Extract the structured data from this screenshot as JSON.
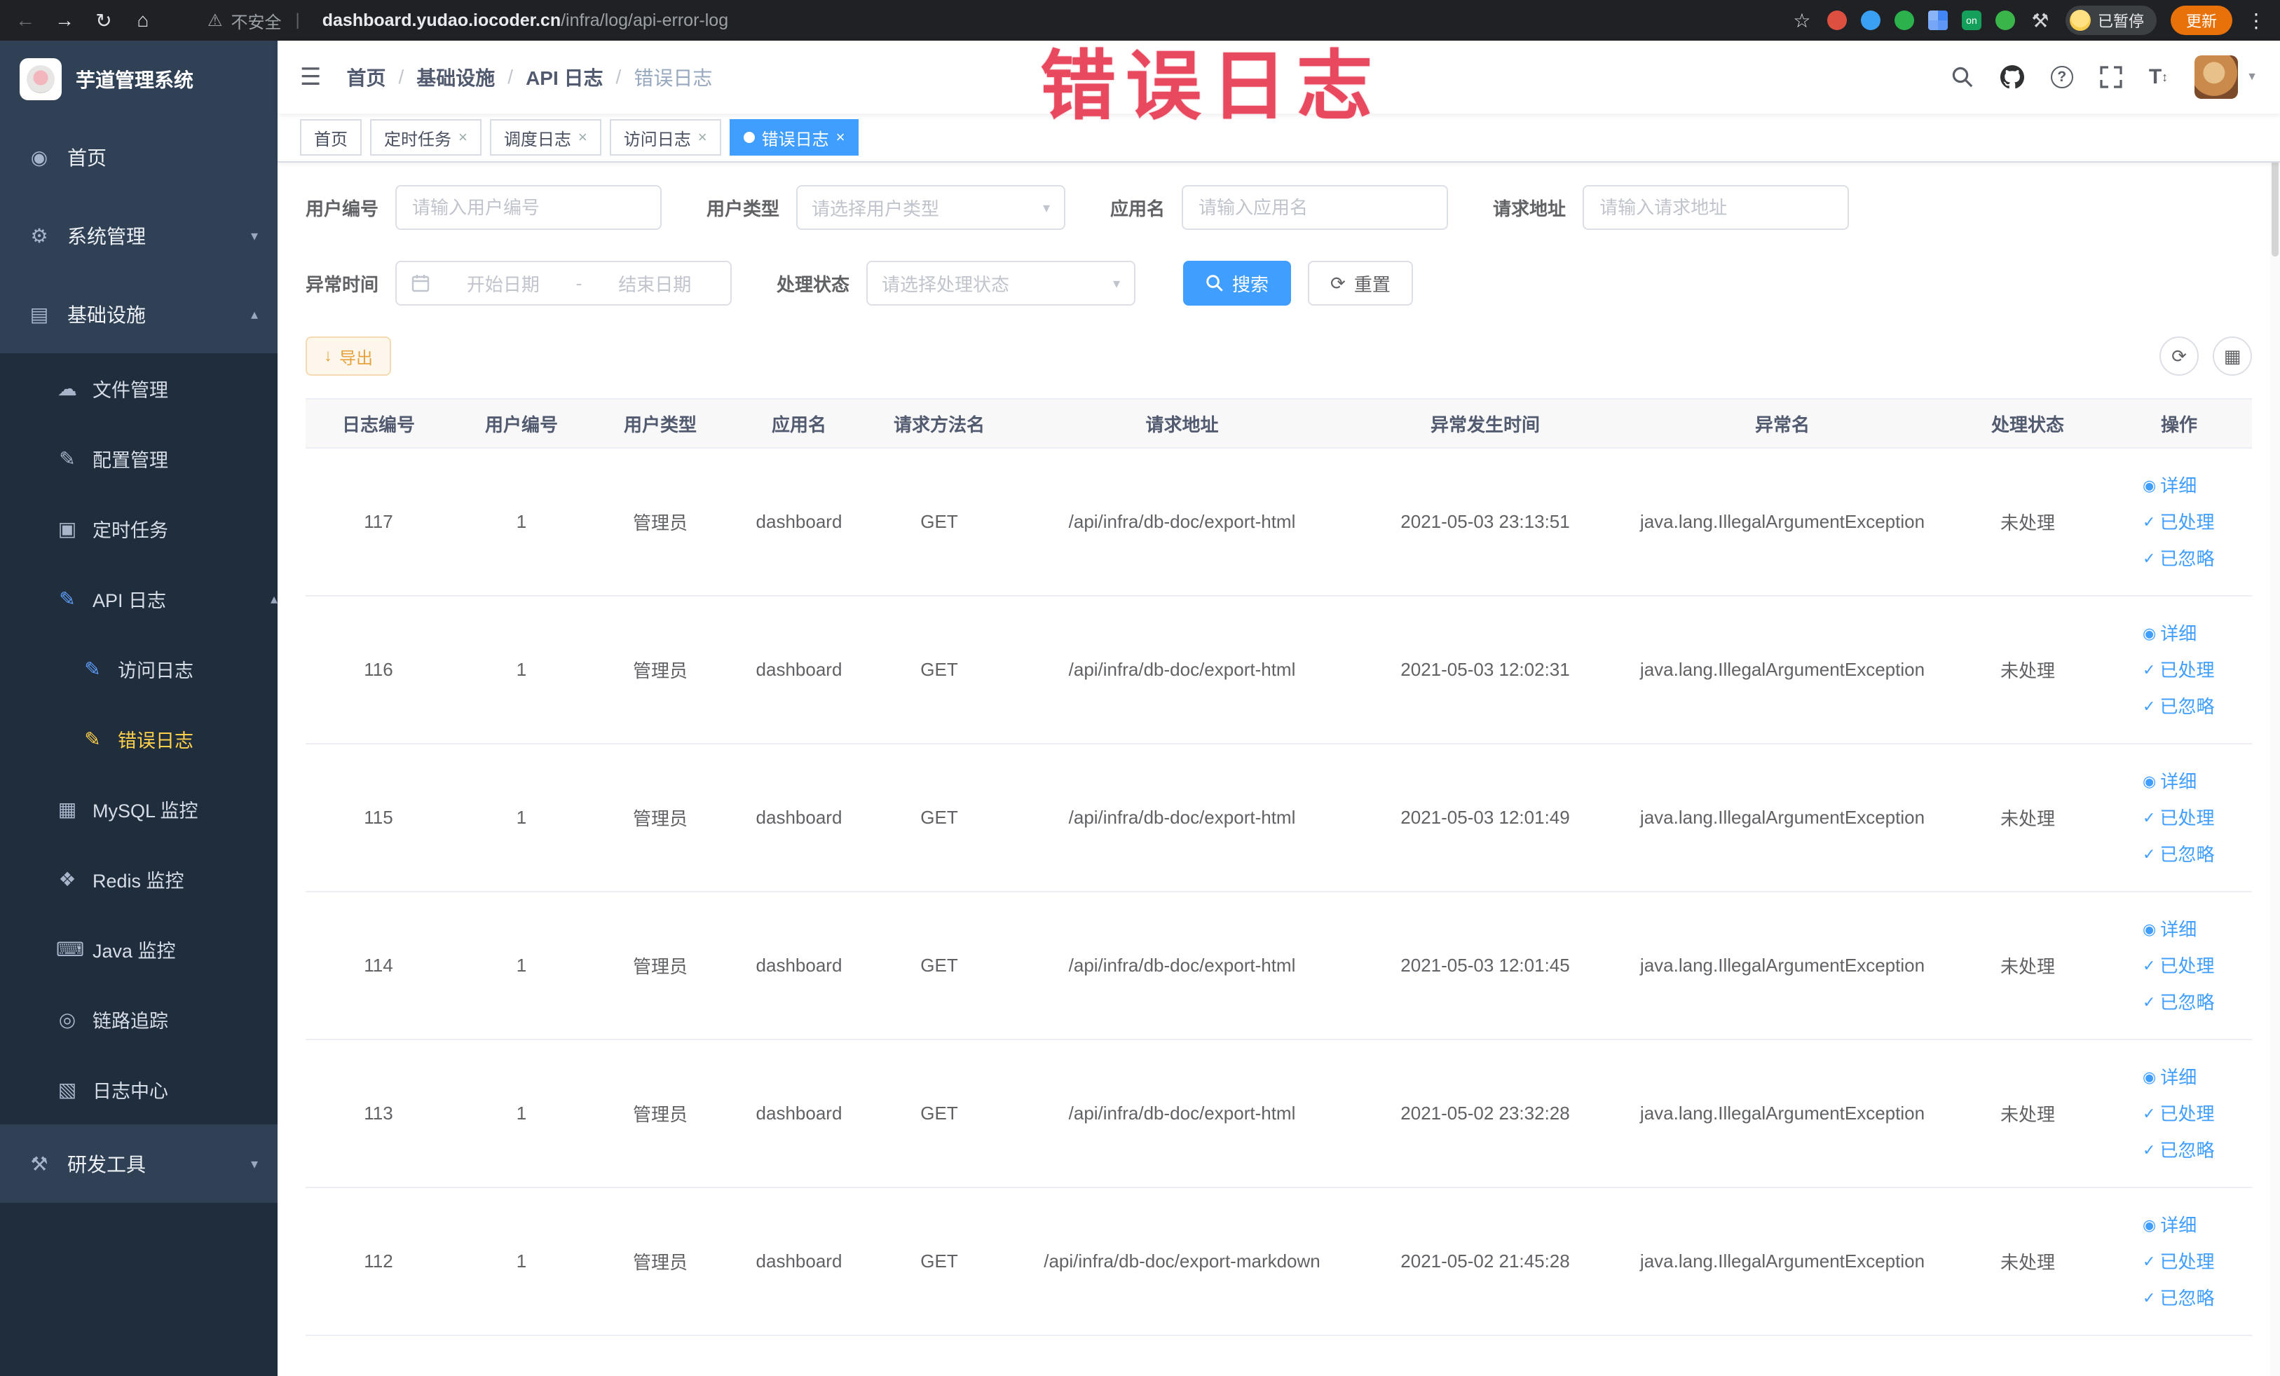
{
  "browser": {
    "security_label": "不安全",
    "url_host": "dashboard.yudao.iocoder.cn",
    "url_path": "/infra/log/api-error-log",
    "paused_label": "已暂停",
    "update_label": "更新",
    "ext_on_label": "on"
  },
  "watermark": "错误日志",
  "icons": {
    "back": "←",
    "forward": "→",
    "reload": "↻",
    "home": "⌂",
    "warning": "⚠",
    "separator": "|",
    "star": "☆",
    "menu_dots": "⋮",
    "hamburger": "☰",
    "question": "?",
    "caret_down": "▼",
    "chevron_down": "▾",
    "chevron_up": "▴",
    "select_chevron": "▾",
    "close": "×",
    "menu_home": "◉",
    "menu_system": "⚙",
    "menu_infra": "▤",
    "menu_file": "☁",
    "menu_config": "✎",
    "menu_job": "▣",
    "menu_apilog": "✎",
    "menu_accesslog": "✎",
    "menu_errorlog": "✎",
    "menu_mysql": "▦",
    "menu_redis": "❖",
    "menu_java": "⌨",
    "menu_trace": "◎",
    "menu_logcenter": "▧",
    "menu_devtools": "⚒",
    "download": "↓",
    "refresh": "⟳",
    "columns": "▦",
    "reset": "⟳",
    "eye": "◉",
    "check": "✓",
    "font_size": "T"
  },
  "sidebar": {
    "logo_title": "芋道管理系统",
    "home": "首页",
    "system": "系统管理",
    "infra": "基础设施",
    "file": "文件管理",
    "config": "配置管理",
    "job": "定时任务",
    "api_log": "API 日志",
    "access_log": "访问日志",
    "error_log": "错误日志",
    "mysql": "MySQL 监控",
    "redis": "Redis 监控",
    "java": "Java 监控",
    "trace": "链路追踪",
    "log_center": "日志中心",
    "dev_tools": "研发工具"
  },
  "header": {
    "breadcrumb": [
      "首页",
      "基础设施",
      "API 日志",
      "错误日志"
    ]
  },
  "tabs": [
    {
      "label": "首页"
    },
    {
      "label": "定时任务"
    },
    {
      "label": "调度日志"
    },
    {
      "label": "访问日志"
    },
    {
      "label": "错误日志"
    }
  ],
  "filters": {
    "user_id_label": "用户编号",
    "user_id_placeholder": "请输入用户编号",
    "user_type_label": "用户类型",
    "user_type_placeholder": "请选择用户类型",
    "app_name_label": "应用名",
    "app_name_placeholder": "请输入应用名",
    "request_url_label": "请求地址",
    "request_url_placeholder": "请输入请求地址",
    "exception_time_label": "异常时间",
    "start_date_placeholder": "开始日期",
    "date_separator": "-",
    "end_date_placeholder": "结束日期",
    "process_status_label": "处理状态",
    "process_status_placeholder": "请选择处理状态",
    "search_label": "搜索",
    "reset_label": "重置"
  },
  "toolbar": {
    "export_label": "导出"
  },
  "table": {
    "columns": [
      "日志编号",
      "用户编号",
      "用户类型",
      "应用名",
      "请求方法名",
      "请求地址",
      "异常发生时间",
      "异常名",
      "处理状态",
      "操作"
    ],
    "actions": [
      "详细",
      "已处理",
      "已忽略"
    ],
    "rows": [
      {
        "id": "117",
        "user_id": "1",
        "user_type": "管理员",
        "app": "dashboard",
        "method": "GET",
        "url": "/api/infra/db-doc/export-html",
        "time": "2021-05-03 23:13:51",
        "exception": "java.lang.IllegalArgumentException",
        "status": "未处理"
      },
      {
        "id": "116",
        "user_id": "1",
        "user_type": "管理员",
        "app": "dashboard",
        "method": "GET",
        "url": "/api/infra/db-doc/export-html",
        "time": "2021-05-03 12:02:31",
        "exception": "java.lang.IllegalArgumentException",
        "status": "未处理"
      },
      {
        "id": "115",
        "user_id": "1",
        "user_type": "管理员",
        "app": "dashboard",
        "method": "GET",
        "url": "/api/infra/db-doc/export-html",
        "time": "2021-05-03 12:01:49",
        "exception": "java.lang.IllegalArgumentException",
        "status": "未处理"
      },
      {
        "id": "114",
        "user_id": "1",
        "user_type": "管理员",
        "app": "dashboard",
        "method": "GET",
        "url": "/api/infra/db-doc/export-html",
        "time": "2021-05-03 12:01:45",
        "exception": "java.lang.IllegalArgumentException",
        "status": "未处理"
      },
      {
        "id": "113",
        "user_id": "1",
        "user_type": "管理员",
        "app": "dashboard",
        "method": "GET",
        "url": "/api/infra/db-doc/export-html",
        "time": "2021-05-02 23:32:28",
        "exception": "java.lang.IllegalArgumentException",
        "status": "未处理"
      },
      {
        "id": "112",
        "user_id": "1",
        "user_type": "管理员",
        "app": "dashboard",
        "method": "GET",
        "url": "/api/infra/db-doc/export-markdown",
        "time": "2021-05-02 21:45:28",
        "exception": "java.lang.IllegalArgumentException",
        "status": "未处理"
      }
    ]
  },
  "colors": {
    "primary": "#409eff",
    "sidebar_bg": "#304156",
    "submenu_bg": "#1f2d3d",
    "active_menu": "#ffd04b",
    "watermark": "#e8495f"
  }
}
